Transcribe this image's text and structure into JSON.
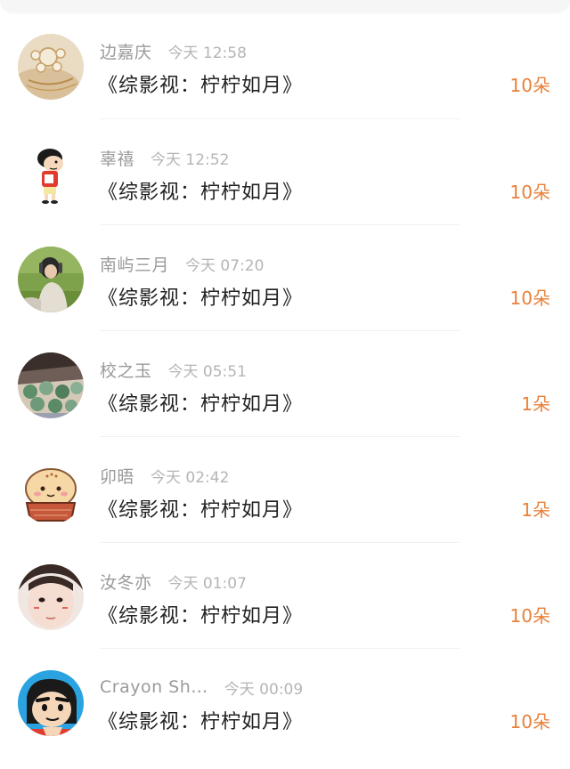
{
  "accent_color": "#e8813a",
  "entries": [
    {
      "name": "边嘉庆",
      "time": "今天 12:58",
      "title": "《综影视：柠柠如月》",
      "amount": "10朵",
      "avatar": "jewelry-brooch"
    },
    {
      "name": "辜禧",
      "time": "今天 12:52",
      "title": "《综影视：柠柠如月》",
      "amount": "10朵",
      "avatar": "cartoon-boy"
    },
    {
      "name": "南屿三月",
      "time": "今天 07:20",
      "title": "《综影视：柠柠如月》",
      "amount": "10朵",
      "avatar": "person-on-grass"
    },
    {
      "name": "校之玉",
      "time": "今天 05:51",
      "title": "《综影视：柠柠如月》",
      "amount": "1朵",
      "avatar": "succulent-plants"
    },
    {
      "name": "卯晤",
      "time": "今天 02:42",
      "title": "《综影视：柠柠如月》",
      "amount": "1朵",
      "avatar": "cartoon-bun"
    },
    {
      "name": "汝冬亦",
      "time": "今天 01:07",
      "title": "《综影视：柠柠如月》",
      "amount": "10朵",
      "avatar": "girl-face"
    },
    {
      "name": "Crayon Sh…",
      "time": "今天 00:09",
      "title": "《综影视：柠柠如月》",
      "amount": "10朵",
      "avatar": "crayon-shin-chan"
    }
  ]
}
